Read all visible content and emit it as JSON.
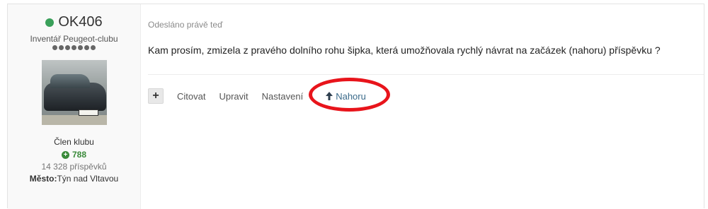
{
  "author": {
    "name": "OK406",
    "title": "Inventář Peugeot-clubu",
    "rank_dots": 7,
    "member_group": "Člen klubu",
    "reputation": "788",
    "post_count": "14 328 příspěvků",
    "location_label": "Město:",
    "location_value": "Týn nad Vltavou"
  },
  "post": {
    "timestamp": "Odesláno právě teď",
    "message": "Kam prosím, zmizela z pravého dolního rohu šipka, která umožňovala rychlý návrat na začázek (nahoru) příspěvku ?"
  },
  "controls": {
    "plus_label": "+",
    "quote_label": "Citovat",
    "edit_label": "Upravit",
    "settings_label": "Nastavení",
    "top_label": "Nahoru"
  },
  "colors": {
    "online": "#3aa05a",
    "reputation": "#3a8a3a",
    "highlight": "#e8141b",
    "link": "#3a6a8a"
  },
  "icons": {
    "online": "online-dot-icon",
    "rank": "rank-dots-icon",
    "reputation": "plus-circle-icon",
    "top": "arrow-up-icon"
  }
}
